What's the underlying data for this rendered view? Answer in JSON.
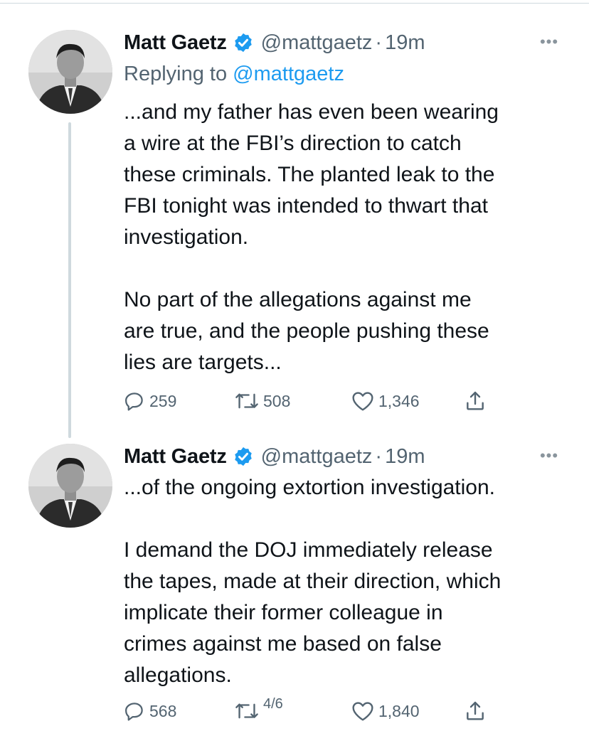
{
  "tweets": [
    {
      "author_name": "Matt Gaetz",
      "handle": "@mattgaetz",
      "separator": "·",
      "time": "19m",
      "more_label": "•••",
      "replying_prefix": "Replying to",
      "replying_handle": "@mattgaetz",
      "text": "...and my father has even been wearing\na wire at the FBI’s direction to catch\nthese criminals. The planted leak to the\nFBI tonight was intended to thwart that\ninvestigation.\n\nNo part of the allegations against me\nare true, and the people pushing these\nlies are targets...",
      "replies": "259",
      "retweets": "508",
      "likes": "1,346"
    },
    {
      "author_name": "Matt Gaetz",
      "handle": "@mattgaetz",
      "separator": "·",
      "time": "19m",
      "more_label": "•••",
      "text": "...of the ongoing extortion investigation.\n\nI demand the DOJ immediately release\nthe tapes, made at their direction, which\nimplicate their former colleague in\ncrimes against me based on false\nallegations.",
      "replies": "568",
      "retweets": "4/6",
      "likes": "1,840"
    }
  ],
  "colors": {
    "text": "#0f1419",
    "secondary": "#536471",
    "accent": "#1d9bf0",
    "divider": "#cfd9de"
  },
  "icons": [
    "verified-badge-icon",
    "more-icon",
    "reply-icon",
    "retweet-icon",
    "like-icon",
    "share-icon"
  ]
}
